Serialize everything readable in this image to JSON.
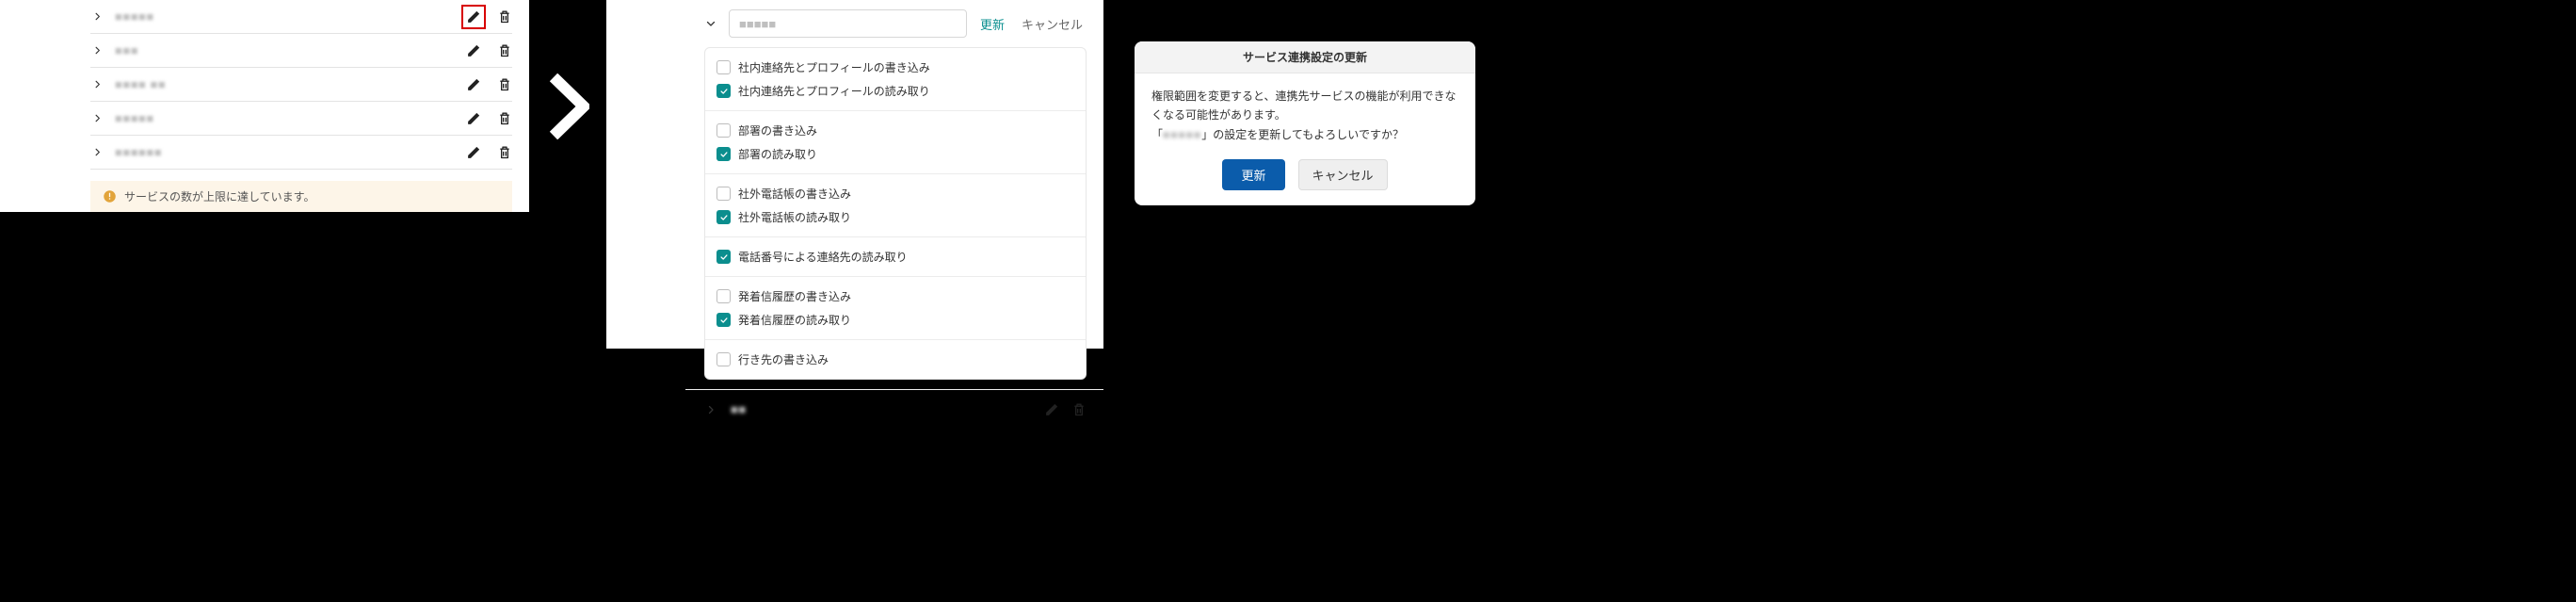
{
  "panel1": {
    "rows": [
      {
        "name": "■■■■■"
      },
      {
        "name": "■■■"
      },
      {
        "name": "■■■■ ■■"
      },
      {
        "name": "■■■■■"
      },
      {
        "name": "■■■■■■"
      }
    ],
    "alert_text": "サービスの数が上限に達しています。"
  },
  "panel2": {
    "title_value": "■■■■■",
    "update_label": "更新",
    "cancel_label": "キャンセル",
    "groups": [
      {
        "options": [
          {
            "label": "社内連絡先とプロフィールの書き込み",
            "checked": false
          },
          {
            "label": "社内連絡先とプロフィールの読み取り",
            "checked": true
          }
        ]
      },
      {
        "options": [
          {
            "label": "部署の書き込み",
            "checked": false
          },
          {
            "label": "部署の読み取り",
            "checked": true
          }
        ]
      },
      {
        "options": [
          {
            "label": "社外電話帳の書き込み",
            "checked": false
          },
          {
            "label": "社外電話帳の読み取り",
            "checked": true
          }
        ]
      },
      {
        "options": [
          {
            "label": "電話番号による連絡先の読み取り",
            "checked": true
          }
        ]
      },
      {
        "options": [
          {
            "label": "発着信履歴の書き込み",
            "checked": false
          },
          {
            "label": "発着信履歴の読み取り",
            "checked": true
          }
        ]
      },
      {
        "options": [
          {
            "label": "行き先の書き込み",
            "checked": false
          }
        ]
      }
    ],
    "footer_name": "■■"
  },
  "panel3": {
    "title": "サービス連携設定の更新",
    "body_line1": "権限範囲を変更すると、連携先サービスの機能が利用できなくなる可能性があります。",
    "body_line2_prefix": "「",
    "body_line2_name": "■■■■■",
    "body_line2_suffix": "」の設定を更新してもよろしいですか？",
    "update_label": "更新",
    "cancel_label": "キャンセル"
  }
}
